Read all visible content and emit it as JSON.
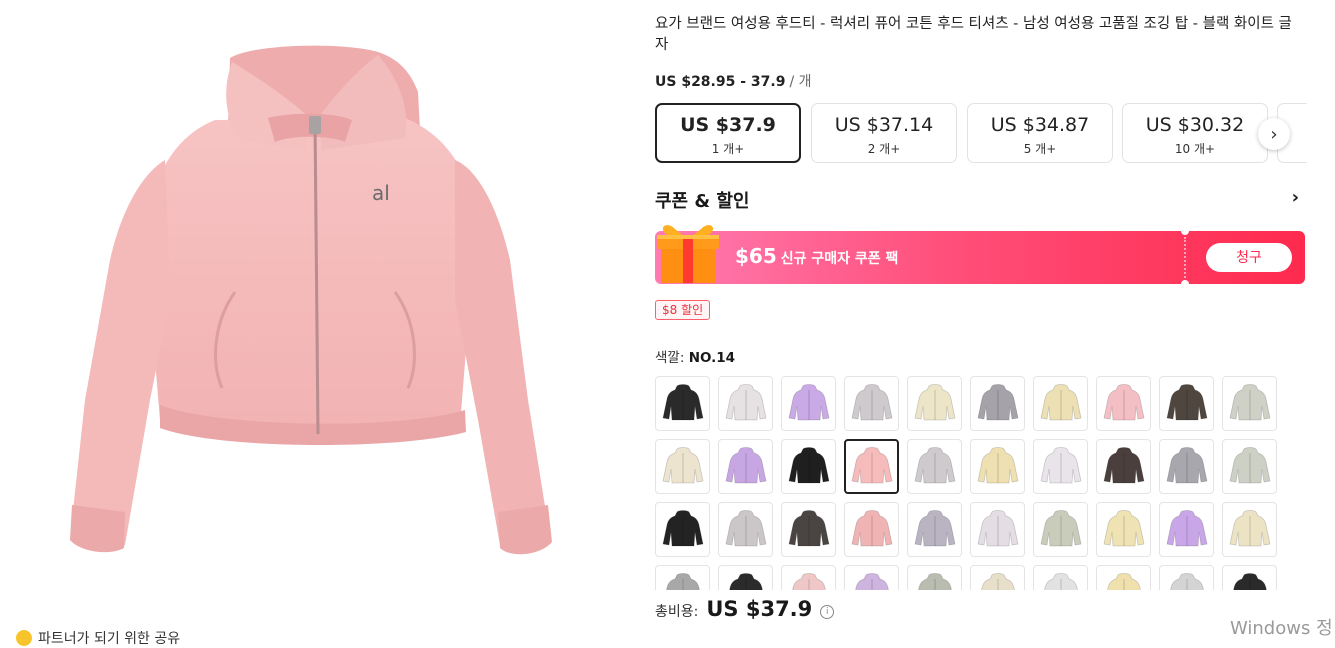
{
  "product": {
    "title": "요가 브랜드 여성용 후드티 - 럭셔리 퓨어 코튼 후드 티셔츠 - 남성 여성용 고품질 조깅 탑 - 블랙 화이트 글자",
    "price_range": "US $28.95 - 37.9",
    "price_unit": "/ 개",
    "image_alt": "pink cropped zip-up hoodie",
    "logo_text": "al",
    "image_color": "#f6bcbc"
  },
  "tiers": [
    {
      "price": "US $37.9",
      "qty": "1 개+",
      "selected": true
    },
    {
      "price": "US $37.14",
      "qty": "2 개+",
      "selected": false
    },
    {
      "price": "US $34.87",
      "qty": "5 개+",
      "selected": false
    },
    {
      "price": "US $30.32",
      "qty": "10 개+",
      "selected": false
    }
  ],
  "coupon": {
    "heading": "쿠폰 & 할인",
    "amount": "$65",
    "description": "신규 구매자 쿠폰 팩",
    "claim_label": "청구",
    "discount_tag": "$8 할인",
    "gradient_start": "#ff7bb1",
    "gradient_end": "#ff2a4e"
  },
  "color": {
    "label": "색깔:",
    "selected": "NO.14",
    "swatches": [
      "#2a2a2a",
      "#e6e1e3",
      "#c9a9e6",
      "#cfcacd",
      "#ede5c8",
      "#a5a2aa",
      "#ece0b4",
      "#f4bfc4",
      "#4e463f",
      "#cfd0c6",
      "#ede4cf",
      "#c8a6e4",
      "#1f1f1f",
      "#f6bcbc",
      "#cfcacd",
      "#eee0b0",
      "#e8e4ea",
      "#4a3f3d",
      "#a9a7ae",
      "#cdd0c5",
      "#232323",
      "#cbc7c9",
      "#4a4442",
      "#f0b4b4",
      "#b9b3c2",
      "#e4dde4",
      "#c9cbbb",
      "#efe3b3",
      "#c9a6e8",
      "#ece3c5",
      "#a8a8a8",
      "#2b2b2b",
      "#efc7c7",
      "#cdb5e0",
      "#b8bdb0",
      "#e7dfc9",
      "#e2e2e2",
      "#efe0ad",
      "#d4d4d4",
      "#2a2a2a"
    ],
    "selected_index": 13
  },
  "total": {
    "label": "총비용:",
    "amount": "US $37.9"
  },
  "share": {
    "text": "파트너가 되기 위한 공유"
  },
  "os_watermark": "Windows 정"
}
